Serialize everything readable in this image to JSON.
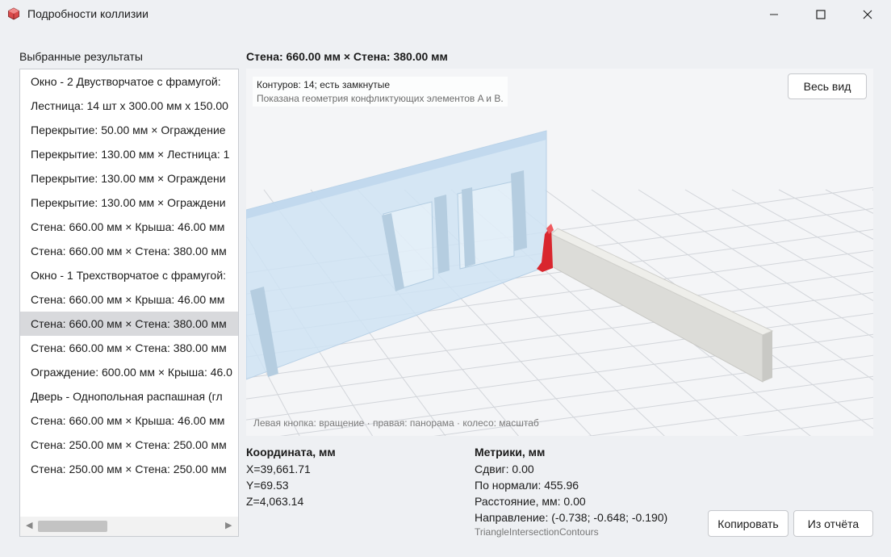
{
  "window": {
    "title": "Подробности коллизии"
  },
  "left_panel": {
    "label": "Выбранные результаты",
    "items": [
      "Окно - 2 Двустворчатое с фрамугой: ",
      "Лестница: 14 шт x 300.00 мм x 150.00 ",
      "Перекрытие: 50.00 мм × Ограждение",
      "Перекрытие: 130.00 мм × Лестница: 1",
      "Перекрытие: 130.00 мм × Ограждени",
      "Перекрытие: 130.00 мм × Ограждени",
      "Стена: 660.00 мм × Крыша: 46.00 мм",
      "Стена: 660.00 мм × Стена: 380.00 мм",
      "Окно - 1 Трехстворчатое с фрамугой:",
      "Стена: 660.00 мм × Крыша: 46.00 мм",
      "Стена: 660.00 мм × Стена: 380.00 мм",
      "Стена: 660.00 мм × Стена: 380.00 мм",
      "Ограждение: 600.00 мм × Крыша: 46.0",
      "Дверь - Однопольная распашная (гл",
      "Стена: 660.00 мм × Крыша: 46.00 мм",
      "Стена: 250.00 мм × Стена: 250.00 мм",
      "Стена: 250.00 мм × Стена: 250.00 мм"
    ],
    "selected_index": 10
  },
  "viewer": {
    "title": "Стена: 660.00 мм × Стена: 380.00 мм",
    "contours_text": "Контуров: 14; есть замкнутые",
    "geometry_note": "Показана геометрия конфликтующих элементов A и B.",
    "fit_button": "Весь вид",
    "hint": "Левая кнопка: вращение · правая: панорама · колесо: масштаб"
  },
  "coordinates": {
    "heading": "Координата, мм",
    "x": "X=39,661.71",
    "y": "Y=69.53",
    "z": "Z=4,063.14"
  },
  "metrics": {
    "heading": "Метрики, мм",
    "shift": "Сдвиг: 0.00",
    "normal": "По нормали: 455.96",
    "distance": "Расстояние, мм: 0.00",
    "direction": "Направление: (-0.738; -0.648; -0.190)",
    "method": "TriangleIntersectionContours"
  },
  "buttons": {
    "copy": "Копировать",
    "report": "Из отчёта"
  },
  "colors": {
    "wall_a": "#cfe3f3",
    "wall_b": "#e6e6e2",
    "collision": "#d9262e"
  }
}
